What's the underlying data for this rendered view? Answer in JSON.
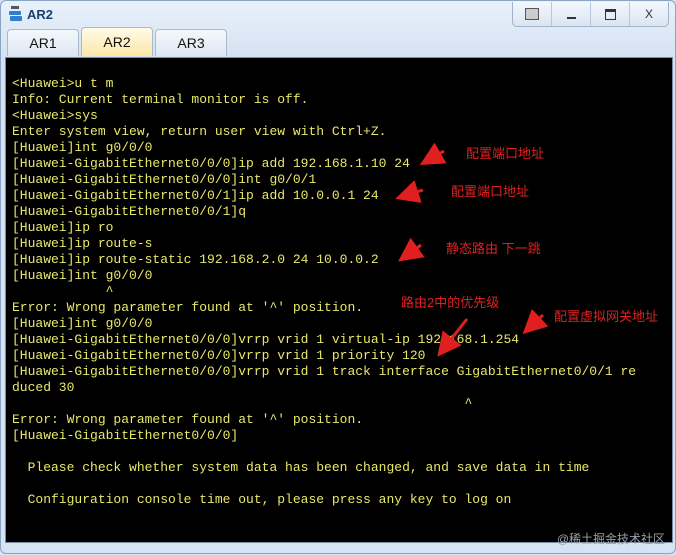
{
  "window": {
    "title": "AR2",
    "controls": [
      "restore",
      "minimize",
      "maximize",
      "close"
    ],
    "close_label": "X"
  },
  "tabs": [
    {
      "label": "AR1"
    },
    {
      "label": "AR2",
      "active": true
    },
    {
      "label": "AR3"
    }
  ],
  "terminal": {
    "lines": [
      "<Huawei>u t m",
      "Info: Current terminal monitor is off.",
      "<Huawei>sys",
      "Enter system view, return user view with Ctrl+Z.",
      "[Huawei]int g0/0/0",
      "[Huawei-GigabitEthernet0/0/0]ip add 192.168.1.10 24",
      "[Huawei-GigabitEthernet0/0/0]int g0/0/1",
      "[Huawei-GigabitEthernet0/0/1]ip add 10.0.0.1 24",
      "[Huawei-GigabitEthernet0/0/1]q",
      "[Huawei]ip ro",
      "[Huawei]ip route-s",
      "[Huawei]ip route-static 192.168.2.0 24 10.0.0.2",
      "[Huawei]int g0/0/0",
      "            ^",
      "Error: Wrong parameter found at '^' position.",
      "[Huawei]int g0/0/0",
      "[Huawei-GigabitEthernet0/0/0]vrrp vrid 1 virtual-ip 192.168.1.254",
      "[Huawei-GigabitEthernet0/0/0]vrrp vrid 1 priority 120",
      "[Huawei-GigabitEthernet0/0/0]vrrp vrid 1 track interface GigabitEthernet0/0/1 re",
      "duced 30",
      "                                                          ^",
      "Error: Wrong parameter found at '^' position.",
      "[Huawei-GigabitEthernet0/0/0]",
      "",
      "  Please check whether system data has been changed, and save data in time",
      "",
      "  Configuration console time out, please press any key to log on"
    ]
  },
  "annotations": [
    {
      "text": "配置端口地址"
    },
    {
      "text": "配置端口地址"
    },
    {
      "text": "静态路由  下一跳"
    },
    {
      "text": "路由2中的优先级"
    },
    {
      "text": "配置虚拟网关地址"
    }
  ],
  "watermark": "@稀土掘金技术社区",
  "colors": {
    "terminal_text": "#e8e86a",
    "annotation": "#e02020",
    "terminal_bg": "#000000"
  }
}
